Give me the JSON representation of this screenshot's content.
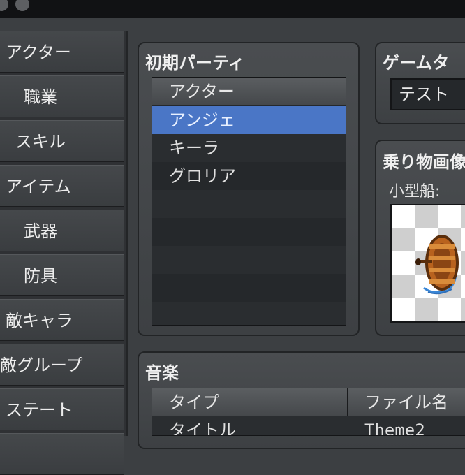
{
  "sidebar": {
    "items": [
      {
        "label": "アクター"
      },
      {
        "label": "職業"
      },
      {
        "label": "スキル"
      },
      {
        "label": "アイテム"
      },
      {
        "label": "武器"
      },
      {
        "label": "防具"
      },
      {
        "label": "敵キャラ"
      },
      {
        "label": "敵グループ"
      },
      {
        "label": "ステート"
      }
    ]
  },
  "party": {
    "title": "初期パーティ",
    "column_header": "アクター",
    "members": [
      "アンジェ",
      "キーラ",
      "グロリア"
    ],
    "selected_index": 0
  },
  "game_title": {
    "title": "ゲームタ",
    "value": "テスト"
  },
  "vehicle": {
    "title": "乗り物画像",
    "boat_label": "小型船:",
    "boat_icon": "rowboat-sprite"
  },
  "music": {
    "title": "音楽",
    "columns": [
      "タイプ",
      "ファイル名"
    ],
    "rows": [
      {
        "type": "タイトル",
        "file": "Theme2"
      }
    ]
  },
  "colors": {
    "selection": "#4a76c6",
    "background": "#3c3f42"
  }
}
